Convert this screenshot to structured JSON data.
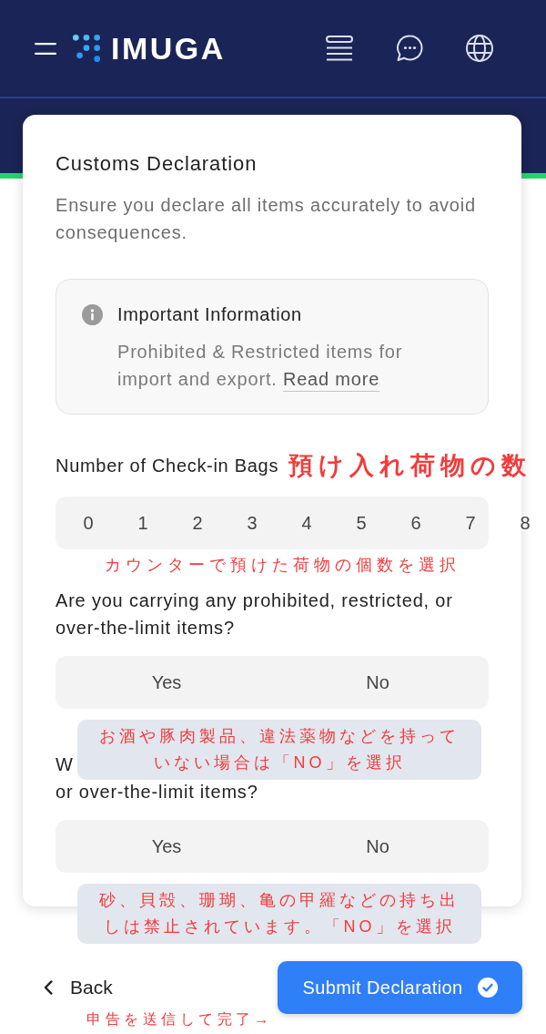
{
  "header": {
    "app_name": "IMUGA"
  },
  "card": {
    "title": "Customs Declaration",
    "subtitle": "Ensure you declare all items accurately to avoid consequences.",
    "info": {
      "title": "Important Information",
      "text": "Prohibited & Restricted items for import and export.",
      "link": "Read more"
    },
    "bags": {
      "label": "Number of Check-in Bags",
      "annotation": "預け入れ荷物の数",
      "options": [
        {
          "label": "0",
          "selected": false
        },
        {
          "label": "1",
          "selected": false
        },
        {
          "label": "2",
          "selected": false
        },
        {
          "label": "3",
          "selected": false
        },
        {
          "label": "4",
          "selected": false
        },
        {
          "label": "5",
          "selected": false
        },
        {
          "label": "6",
          "selected": false
        },
        {
          "label": "7",
          "selected": false
        },
        {
          "label": "8",
          "selected": false
        }
      ],
      "caption": "カウンターで預けた荷物の個数を選択"
    },
    "questions": [
      {
        "lines": [
          "Are you carrying any prohibited, restricted, or over-the-limit items?"
        ],
        "options": [
          {
            "label": "Yes",
            "selected": false
          },
          {
            "label": "No",
            "selected": false
          }
        ],
        "note": "お酒や豚肉製品、違法薬物などを持っていない場合は「NO」を選択"
      },
      {
        "lines": [
          "W",
          "or over-the-limit items?"
        ],
        "options": [
          {
            "label": "Yes",
            "selected": false
          },
          {
            "label": "No",
            "selected": false
          }
        ],
        "note": "砂、貝殻、珊瑚、亀の甲羅などの持ち出しは禁止されています。「NO」を選択"
      }
    ]
  },
  "footer": {
    "back": "Back",
    "submit": "Submit Declaration",
    "caption": "申告を送信して完了→"
  }
}
